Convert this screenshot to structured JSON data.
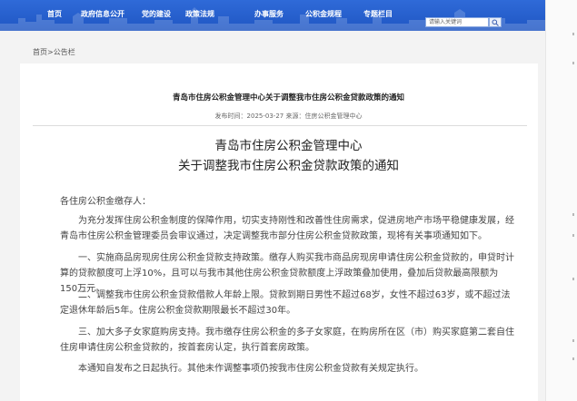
{
  "nav": {
    "items": [
      "首页",
      "政府信息公开",
      "党的建设",
      "政策法规",
      "办事服务",
      "公积金规程",
      "专题栏目"
    ],
    "search_placeholder": "请输入关键词"
  },
  "breadcrumb": "首页>公告栏",
  "article": {
    "title": "青岛市住房公积金管理中心关于调整我市住房公积金贷款政策的通知",
    "meta": "发布时间：2025-03-27  来源：住房公积金管理中心",
    "heading_line1": "青岛市住房公积金管理中心",
    "heading_line2": "关于调整我市住房公积金贷款政策的通知",
    "salutation": "各住房公积金缴存人：",
    "paragraphs": [
      "为充分发挥住房公积金制度的保障作用，切实支持刚性和改善性住房需求，促进房地产市场平稳健康发展，经青岛市住房公积金管理委员会审议通过，决定调整我市部分住房公积金贷款政策，现将有关事项通知如下。",
      "一、实施商品房现房住房公积金贷款支持政策。缴存人购买我市商品房现房申请住房公积金贷款的，申贷时计算的贷款额度可上浮10%，且可以与我市其他住房公积金贷款额度上浮政策叠加使用，叠加后贷款最高限额为150万元。",
      "二、调整我市住房公积金贷款借款人年龄上限。贷款到期日男性不超过68岁，女性不超过63岁，或不超过法定退休年龄后5年。住房公积金贷款期限最长不超过30年。",
      "三、加大多子女家庭购房支持。我市缴存住房公积金的多子女家庭，在购房所在区（市）购买家庭第二套自住住房申请住房公积金贷款的，按首套房认定，执行首套房政策。",
      "本通知自发布之日起执行。其他未作调整事项仍按我市住房公积金贷款有关规定执行。"
    ]
  },
  "colors": {
    "nav_bg": "#2a63d3",
    "page_bg": "#f3f3f3",
    "card_bg": "#ffffff"
  }
}
